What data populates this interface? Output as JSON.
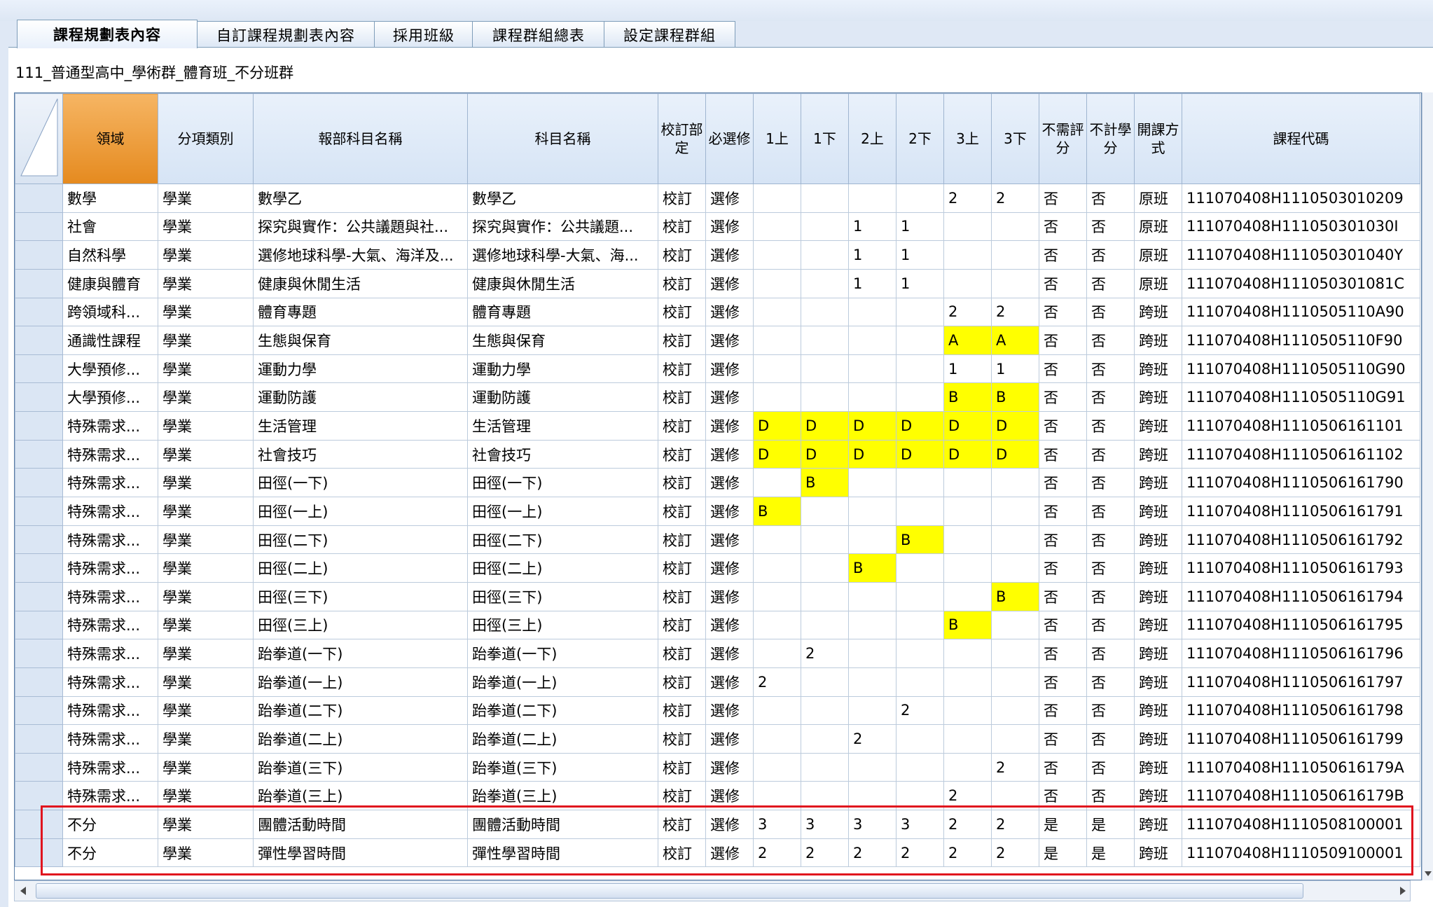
{
  "tabs": [
    {
      "label": "課程規劃表內容",
      "active": true
    },
    {
      "label": "自訂課程規劃表內容",
      "active": false
    },
    {
      "label": "採用班級",
      "active": false
    },
    {
      "label": "課程群組總表",
      "active": false
    },
    {
      "label": "設定課程群組",
      "active": false
    }
  ],
  "caption": "111_普通型高中_學術群_體育班_不分班群",
  "grid": {
    "headers": [
      "領域",
      "分項類別",
      "報部科目名稱",
      "科目名稱",
      "校訂部定",
      "必選修",
      "1上",
      "1下",
      "2上",
      "2下",
      "3上",
      "3下",
      "不需評分",
      "不計學分",
      "開課方式",
      "課程代碼"
    ],
    "highlight_color": "#ffff00",
    "rows": [
      [
        "數學",
        "學業",
        "數學乙",
        "數學乙",
        "校訂",
        "選修",
        "",
        "",
        "",
        "",
        "2",
        "2",
        "否",
        "否",
        "原班",
        "111070408H1110503010209"
      ],
      [
        "社會",
        "學業",
        "探究與實作：公共議題與社...",
        "探究與實作：公共議題...",
        "校訂",
        "選修",
        "",
        "",
        "1",
        "1",
        "",
        "",
        "否",
        "否",
        "原班",
        "111070408H111050301030I"
      ],
      [
        "自然科學",
        "學業",
        "選修地球科學-大氣、海洋及...",
        "選修地球科學-大氣、海...",
        "校訂",
        "選修",
        "",
        "",
        "1",
        "1",
        "",
        "",
        "否",
        "否",
        "原班",
        "111070408H111050301040Y"
      ],
      [
        "健康與體育",
        "學業",
        "健康與休閒生活",
        "健康與休閒生活",
        "校訂",
        "選修",
        "",
        "",
        "1",
        "1",
        "",
        "",
        "否",
        "否",
        "原班",
        "111070408H111050301081C"
      ],
      [
        "跨領域科...",
        "學業",
        "體育專題",
        "體育專題",
        "校訂",
        "選修",
        "",
        "",
        "",
        "",
        "2",
        "2",
        "否",
        "否",
        "跨班",
        "111070408H1110505110A90"
      ],
      [
        "通識性課程",
        "學業",
        "生態與保育",
        "生態與保育",
        "校訂",
        "選修",
        "",
        "",
        "",
        "",
        "A",
        "A",
        "否",
        "否",
        "跨班",
        "111070408H1110505110F90"
      ],
      [
        "大學預修...",
        "學業",
        "運動力學",
        "運動力學",
        "校訂",
        "選修",
        "",
        "",
        "",
        "",
        "1",
        "1",
        "否",
        "否",
        "跨班",
        "111070408H1110505110G90"
      ],
      [
        "大學預修...",
        "學業",
        "運動防護",
        "運動防護",
        "校訂",
        "選修",
        "",
        "",
        "",
        "",
        "B",
        "B",
        "否",
        "否",
        "跨班",
        "111070408H1110505110G91"
      ],
      [
        "特殊需求...",
        "學業",
        "生活管理",
        "生活管理",
        "校訂",
        "選修",
        "D",
        "D",
        "D",
        "D",
        "D",
        "D",
        "否",
        "否",
        "跨班",
        "111070408H1110506161101"
      ],
      [
        "特殊需求...",
        "學業",
        "社會技巧",
        "社會技巧",
        "校訂",
        "選修",
        "D",
        "D",
        "D",
        "D",
        "D",
        "D",
        "否",
        "否",
        "跨班",
        "111070408H1110506161102"
      ],
      [
        "特殊需求...",
        "學業",
        "田徑(一下)",
        "田徑(一下)",
        "校訂",
        "選修",
        "",
        "B",
        "",
        "",
        "",
        "",
        "否",
        "否",
        "跨班",
        "111070408H1110506161790"
      ],
      [
        "特殊需求...",
        "學業",
        "田徑(一上)",
        "田徑(一上)",
        "校訂",
        "選修",
        "B",
        "",
        "",
        "",
        "",
        "",
        "否",
        "否",
        "跨班",
        "111070408H1110506161791"
      ],
      [
        "特殊需求...",
        "學業",
        "田徑(二下)",
        "田徑(二下)",
        "校訂",
        "選修",
        "",
        "",
        "",
        "B",
        "",
        "",
        "否",
        "否",
        "跨班",
        "111070408H1110506161792"
      ],
      [
        "特殊需求...",
        "學業",
        "田徑(二上)",
        "田徑(二上)",
        "校訂",
        "選修",
        "",
        "",
        "B",
        "",
        "",
        "",
        "否",
        "否",
        "跨班",
        "111070408H1110506161793"
      ],
      [
        "特殊需求...",
        "學業",
        "田徑(三下)",
        "田徑(三下)",
        "校訂",
        "選修",
        "",
        "",
        "",
        "",
        "",
        "B",
        "否",
        "否",
        "跨班",
        "111070408H1110506161794"
      ],
      [
        "特殊需求...",
        "學業",
        "田徑(三上)",
        "田徑(三上)",
        "校訂",
        "選修",
        "",
        "",
        "",
        "",
        "B",
        "",
        "否",
        "否",
        "跨班",
        "111070408H1110506161795"
      ],
      [
        "特殊需求...",
        "學業",
        "跆拳道(一下)",
        "跆拳道(一下)",
        "校訂",
        "選修",
        "",
        "2",
        "",
        "",
        "",
        "",
        "否",
        "否",
        "跨班",
        "111070408H1110506161796"
      ],
      [
        "特殊需求...",
        "學業",
        "跆拳道(一上)",
        "跆拳道(一上)",
        "校訂",
        "選修",
        "2",
        "",
        "",
        "",
        "",
        "",
        "否",
        "否",
        "跨班",
        "111070408H1110506161797"
      ],
      [
        "特殊需求...",
        "學業",
        "跆拳道(二下)",
        "跆拳道(二下)",
        "校訂",
        "選修",
        "",
        "",
        "",
        "2",
        "",
        "",
        "否",
        "否",
        "跨班",
        "111070408H1110506161798"
      ],
      [
        "特殊需求...",
        "學業",
        "跆拳道(二上)",
        "跆拳道(二上)",
        "校訂",
        "選修",
        "",
        "",
        "2",
        "",
        "",
        "",
        "否",
        "否",
        "跨班",
        "111070408H1110506161799"
      ],
      [
        "特殊需求...",
        "學業",
        "跆拳道(三下)",
        "跆拳道(三下)",
        "校訂",
        "選修",
        "",
        "",
        "",
        "",
        "",
        "2",
        "否",
        "否",
        "跨班",
        "111070408H111050616179A"
      ],
      [
        "特殊需求...",
        "學業",
        "跆拳道(三上)",
        "跆拳道(三上)",
        "校訂",
        "選修",
        "",
        "",
        "",
        "",
        "2",
        "",
        "否",
        "否",
        "跨班",
        "111070408H111050616179B"
      ],
      [
        "不分",
        "學業",
        "團體活動時間",
        "團體活動時間",
        "校訂",
        "選修",
        "3",
        "3",
        "3",
        "3",
        "2",
        "2",
        "是",
        "是",
        "跨班",
        "111070408H1110508100001"
      ],
      [
        "不分",
        "學業",
        "彈性學習時間",
        "彈性學習時間",
        "校訂",
        "選修",
        "2",
        "2",
        "2",
        "2",
        "2",
        "2",
        "是",
        "是",
        "跨班",
        "111070408H1110509100001"
      ]
    ],
    "highlighted_rows": [
      22,
      23
    ],
    "highlight_box_color": "#e0141e"
  }
}
